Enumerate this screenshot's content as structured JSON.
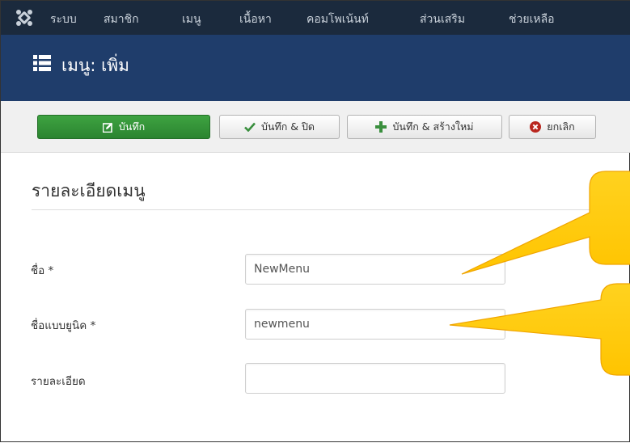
{
  "navbar": {
    "items": [
      "ระบบ",
      "สมาชิก",
      "เมนู",
      "เนื้อหา",
      "คอมโพเน้นท์",
      "ส่วนเสริม",
      "ช่วยเหลือ"
    ]
  },
  "header": {
    "title": "เมนู: เพิ่ม"
  },
  "toolbar": {
    "save_label": "บันทึก",
    "save_close_label": "บันทึก & ปิด",
    "save_new_label": "บันทึก & สร้างใหม่",
    "cancel_label": "ยกเลิก"
  },
  "form": {
    "section_title": "รายละเอียดเมนู",
    "fields": [
      {
        "label": "ชื่อ *",
        "value": "NewMenu"
      },
      {
        "label": "ชื่อแบบยูนิค *",
        "value": "newmenu"
      },
      {
        "label": "รายละเอียด",
        "value": ""
      }
    ]
  },
  "colors": {
    "navbar_bg": "#1b2a3d",
    "titlebar_bg": "#1f3d6b",
    "save_button": "#2f8d34",
    "callout_fill": "#ffcc00",
    "callout_edge": "#f0a500"
  },
  "icons": {
    "logo": "joomla-logo-icon",
    "title": "list-icon",
    "save": "edit-square-icon",
    "save_close": "checkmark-icon",
    "save_new": "plus-icon",
    "cancel": "x-circle-icon"
  }
}
